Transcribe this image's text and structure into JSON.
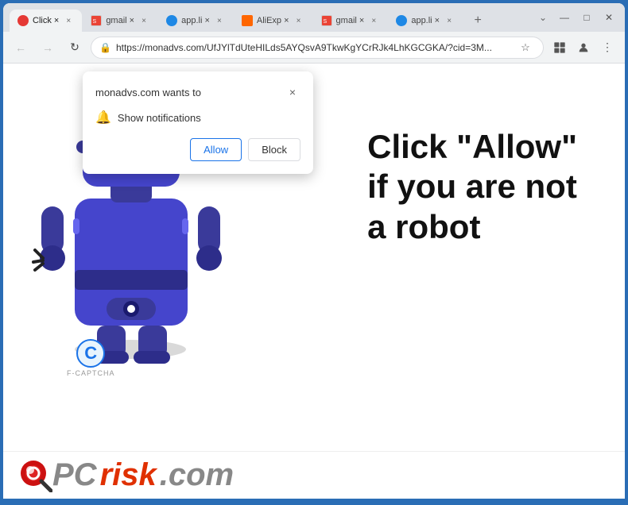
{
  "browser": {
    "tabs": [
      {
        "id": 1,
        "label": "Click ×",
        "favicon": "red",
        "active": true
      },
      {
        "id": 2,
        "label": "gmail ×",
        "favicon": "gmail",
        "active": false
      },
      {
        "id": 3,
        "label": "app.li ×",
        "favicon": "blue",
        "active": false
      },
      {
        "id": 4,
        "label": "AliExp ×",
        "favicon": "orange",
        "active": false
      },
      {
        "id": 5,
        "label": "gmail ×",
        "favicon": "gmail2",
        "active": false
      },
      {
        "id": 6,
        "label": "app.li ×",
        "favicon": "blue2",
        "active": false
      }
    ],
    "new_tab_label": "+",
    "window_controls": {
      "minimize": "—",
      "maximize": "□",
      "close": "✕"
    },
    "nav": {
      "back": "←",
      "forward": "→",
      "reload": "↻",
      "url": "https://monadvs.com/UfJYlTdUteHILds5AYQsvA9TkwKgYCrRJk4LhKGCGKA/?cid=3M...",
      "bookmark": "☆",
      "chrome_menu": "⋮"
    }
  },
  "notification_popup": {
    "title": "monadvs.com wants to",
    "close_btn": "×",
    "permission_icon": "🔔",
    "permission_text": "Show notifications",
    "allow_label": "Allow",
    "block_label": "Block"
  },
  "page": {
    "main_text_line1": "Click \"Allow\"",
    "main_text_line2": "if you are not",
    "main_text_line3": "a robot",
    "captcha_letter": "C",
    "captcha_label": "F-CAPTCHA"
  },
  "footer": {
    "pc_text": "PC",
    "risk_text": "risk",
    "com_text": ".com"
  }
}
